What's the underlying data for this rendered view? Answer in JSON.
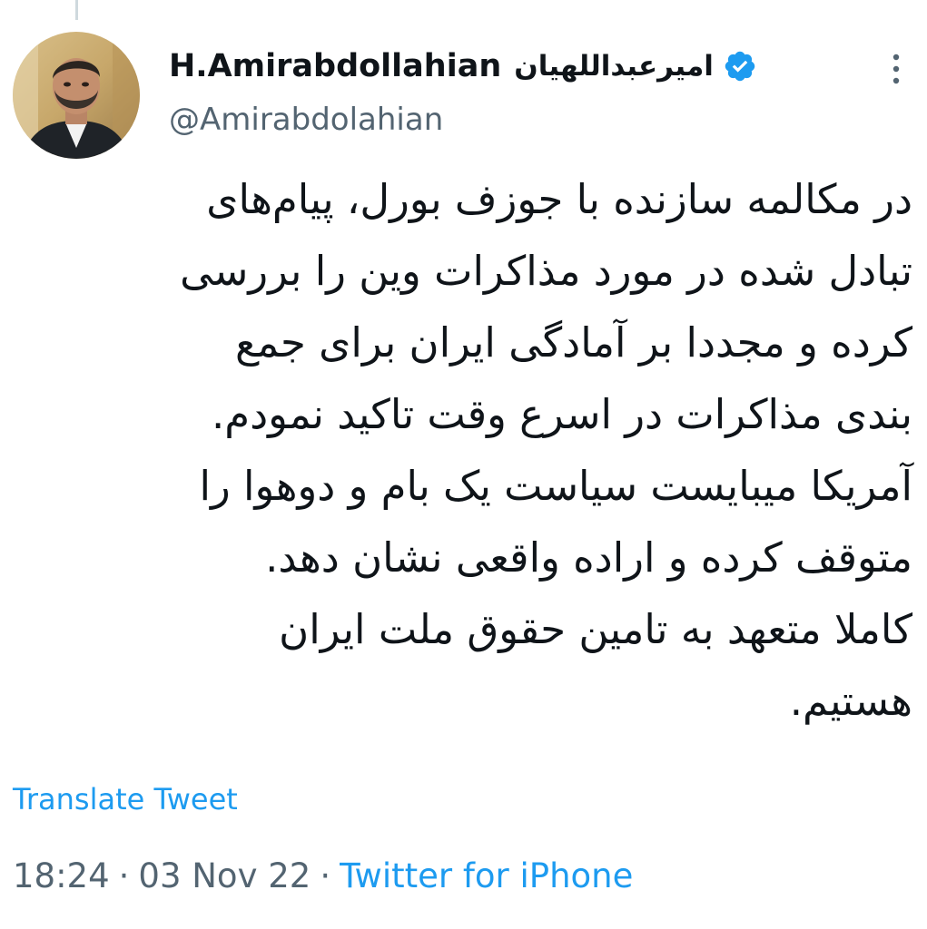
{
  "tweet": {
    "author": {
      "display_name": "H.Amirabdollahian",
      "display_name_fa": "امیرعبداللهیان",
      "handle": "@Amirabdolahian",
      "verified": true,
      "verified_icon": "verified-badge-icon",
      "avatar_icon": "profile-photo"
    },
    "text_lines": [
      "در مکالمه سازنده با جوزف بورل، پیام‌های",
      "تبادل شده در مورد مذاکرات وین را بررسی",
      "کرده و مجددا بر آمادگی ایران برای جمع",
      "بندی مذاکرات در اسرع وقت تاکید نمودم.",
      "آمریکا میبایست سیاست یک بام و دوهوا را",
      "متوقف کرده و اراده واقعی نشان دهد.",
      "کاملا متعهد به تامین حقوق ملت ایران",
      "هستیم."
    ],
    "translate_label": "Translate Tweet",
    "time": "18:24",
    "separator": "·",
    "date": "03 Nov 22",
    "source": "Twitter for iPhone",
    "more_icon": "more-vertical-icon"
  },
  "colors": {
    "link": "#1d9bf0",
    "secondary": "#536471",
    "text": "#0f1419",
    "verified": "#1d9bf0"
  }
}
